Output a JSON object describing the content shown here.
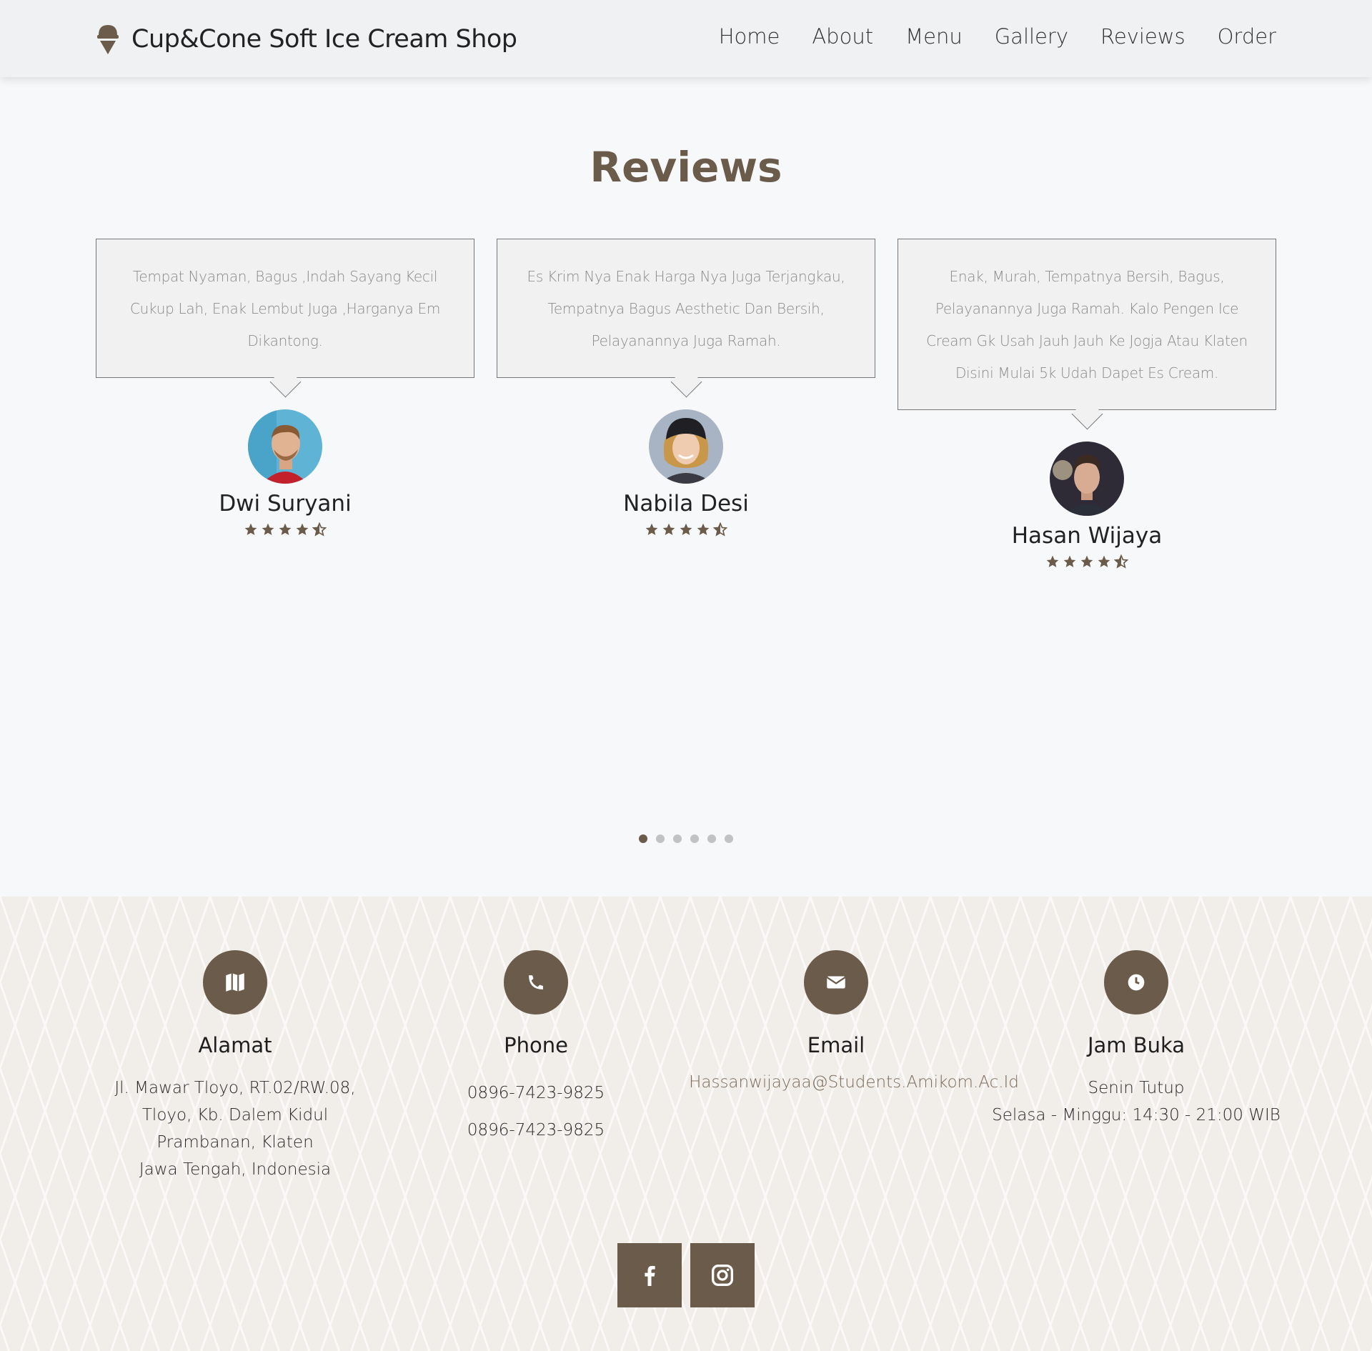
{
  "brand": {
    "name": "Cup&Cone Soft Ice Cream Shop",
    "icon": "ice-cream-icon"
  },
  "nav": {
    "items": [
      "Home",
      "About",
      "Menu",
      "Gallery",
      "Reviews",
      "Order"
    ]
  },
  "reviews": {
    "title": "Reviews",
    "items": [
      {
        "text": "Tempat Nyaman, Bagus ,Indah Sayang Kecil Cukup Lah, Enak Lembut Juga ,Harganya Em Dikantong.",
        "name": "Dwi Suryani",
        "rating": 4.5
      },
      {
        "text": "Es Krim Nya Enak Harga Nya Juga Terjangkau, Tempatnya Bagus Aesthetic Dan Bersih, Pelayanannya Juga Ramah.",
        "name": "Nabila Desi",
        "rating": 4.5
      },
      {
        "text": "Enak, Murah, Tempatnya Bersih, Bagus, Pelayanannya Juga Ramah. Kalo Pengen Ice Cream Gk Usah Jauh Jauh Ke Jogja Atau Klaten Disini Mulai 5k Udah Dapet Es Cream.",
        "name": "Hasan Wijaya",
        "rating": 4.5
      }
    ],
    "pagination": {
      "count": 6,
      "active": 1
    }
  },
  "footer": {
    "alamat": {
      "title": "Alamat",
      "icon": "map-icon",
      "lines": [
        "Jl. Mawar Tloyo, RT.02/RW.08,",
        "Tloyo, Kb. Dalem Kidul",
        "Prambanan, Klaten",
        "Jawa Tengah, Indonesia"
      ]
    },
    "phone": {
      "title": "Phone",
      "icon": "phone-icon",
      "numbers": [
        "0896-7423-9825",
        "0896-7423-9825"
      ]
    },
    "email": {
      "title": "Email",
      "icon": "envelope-icon",
      "address": "Hassanwijayaa@Students.Amikom.Ac.Id"
    },
    "hours": {
      "title": "Jam Buka",
      "icon": "clock-icon",
      "lines": [
        "Senin Tutup",
        "Selasa - Minggu: 14:30 - 21:00 WIB"
      ]
    },
    "social": [
      "facebook-icon",
      "instagram-icon"
    ]
  },
  "colors": {
    "accent": "#6b5b4b",
    "footer_bg": "#f1ede8",
    "page_bg": "#f7f8fa"
  }
}
